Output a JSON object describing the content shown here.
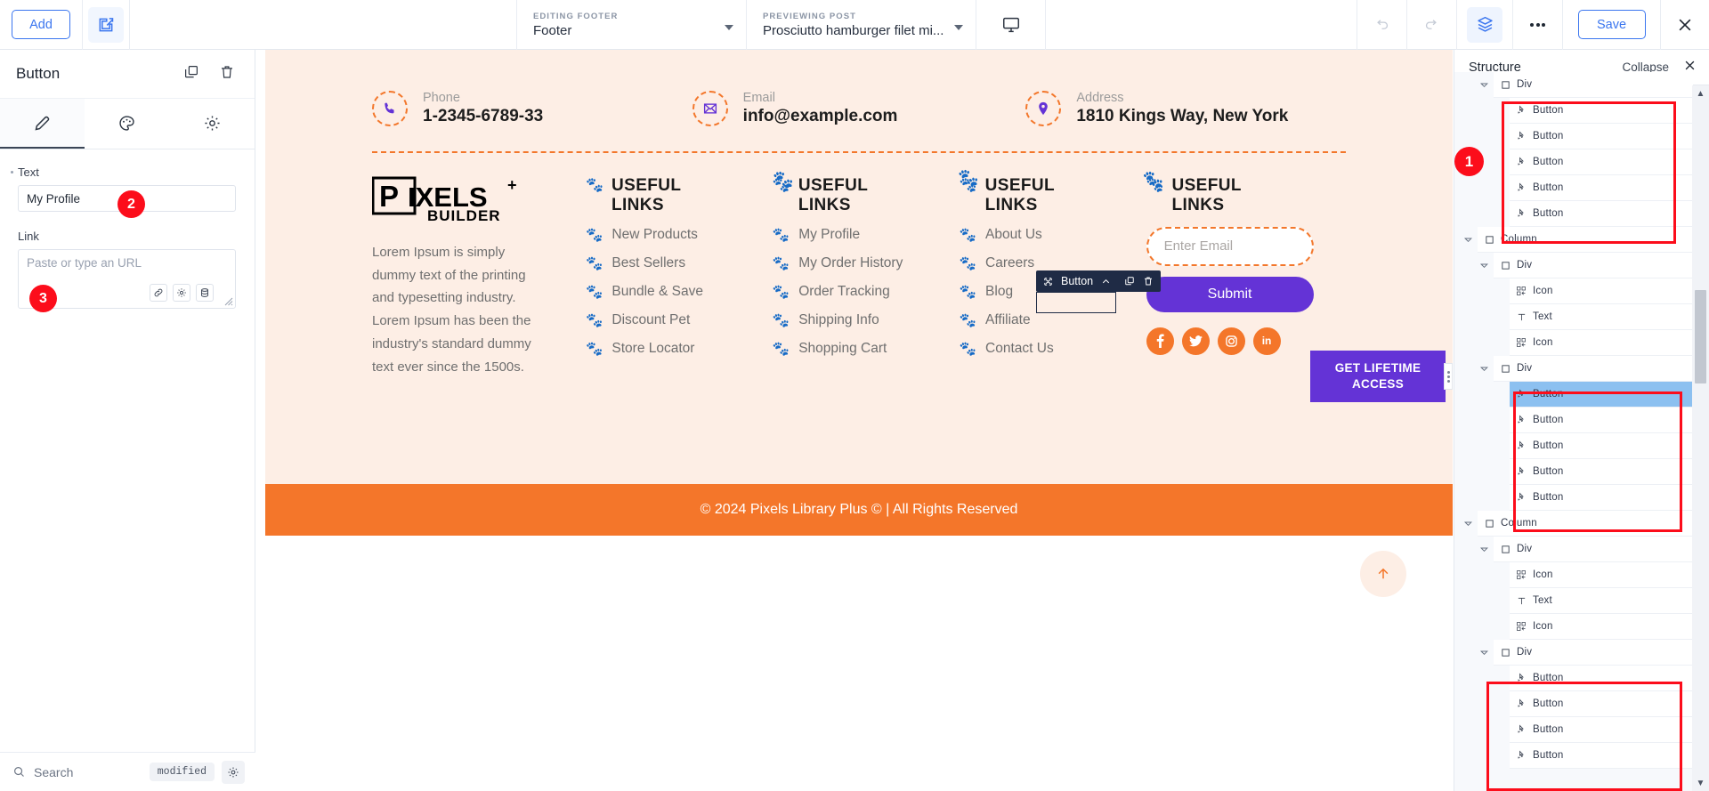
{
  "topbar": {
    "add_label": "Add",
    "edit_icon": "edit-square-icon",
    "editing": {
      "label": "EDITING FOOTER",
      "value": "Footer"
    },
    "previewing": {
      "label": "PREVIEWING POST",
      "value": "Prosciutto hamburger filet mi..."
    },
    "device_icon": "desktop-monitor-icon",
    "undo_icon": "undo-icon",
    "redo_icon": "redo-icon",
    "layers_icon": "layers-icon",
    "more_icon": "more-dots-icon",
    "save_label": "Save",
    "close_icon": "close-icon"
  },
  "left_panel": {
    "title": "Button",
    "duplicate_icon": "duplicate-icon",
    "delete_icon": "trash-icon",
    "tabs": [
      {
        "name": "content",
        "icon": "pencil-icon",
        "active": true
      },
      {
        "name": "style",
        "icon": "palette-icon",
        "active": false
      },
      {
        "name": "advanced",
        "icon": "gear-icon",
        "active": false
      }
    ],
    "text_field": {
      "label": "Text",
      "value": "My Profile"
    },
    "link_field": {
      "label": "Link",
      "placeholder": "Paste or type an URL"
    },
    "link_buttons": [
      {
        "name": "link-icon"
      },
      {
        "name": "gear-icon"
      },
      {
        "name": "database-icon"
      }
    ],
    "footer": {
      "search_placeholder": "Search",
      "status_badge": "modified",
      "settings_icon": "gear-icon"
    }
  },
  "canvas": {
    "contact": [
      {
        "icon": "phone-icon",
        "label": "Phone",
        "value": "1-2345-6789-33"
      },
      {
        "icon": "envelope-icon",
        "label": "Email",
        "value": "info@example.com"
      },
      {
        "icon": "map-pin-icon",
        "label": "Address",
        "value": "1810 Kings Way, New York"
      }
    ],
    "brand": {
      "logo_text": "PIXELS BUILDER",
      "description": "Lorem Ipsum is simply dummy text of the printing and typesetting industry. Lorem Ipsum has been the industry's standard dummy text ever since the 1500s."
    },
    "columns": [
      {
        "heading": "USEFUL LINKS",
        "links": [
          "New Products",
          "Best Sellers",
          "Bundle & Save",
          "Discount Pet",
          "Store Locator"
        ]
      },
      {
        "heading": "USEFUL LINKS",
        "links": [
          "My Profile",
          "My Order History",
          "Order Tracking",
          "Shipping Info",
          "Shopping Cart"
        ]
      },
      {
        "heading": "USEFUL LINKS",
        "links": [
          "About Us",
          "Careers",
          "Blog",
          "Affiliate",
          "Contact Us"
        ]
      }
    ],
    "newsletter": {
      "heading": "USEFUL LINKS",
      "email_placeholder": "Enter Email",
      "submit_label": "Submit",
      "socials": [
        {
          "name": "facebook-icon",
          "glyph": "f"
        },
        {
          "name": "twitter-icon",
          "glyph": "⚑"
        },
        {
          "name": "instagram-icon",
          "glyph": "◎"
        },
        {
          "name": "linkedin-icon",
          "glyph": "in"
        }
      ]
    },
    "cta_label": "GET LIFETIME ACCESS",
    "copyright": "© 2024 Pixels Library Plus © | All Rights Reserved",
    "scroll_top_icon": "arrow-up-icon",
    "element_toolbar": {
      "move_icon": "move-icon",
      "label": "Button",
      "collapse_icon": "chevron-up-icon",
      "duplicate_icon": "duplicate-icon",
      "delete_icon": "trash-icon"
    }
  },
  "structure": {
    "title": "Structure",
    "collapse_label": "Collapse",
    "close_icon": "close-icon",
    "nodes": [
      {
        "label": "Div",
        "icon": "div-icon",
        "depth": 2,
        "arrow": true,
        "selected": false
      },
      {
        "label": "Button",
        "icon": "button-icon",
        "depth": 3,
        "arrow": false,
        "selected": false
      },
      {
        "label": "Button",
        "icon": "button-icon",
        "depth": 3,
        "arrow": false,
        "selected": false
      },
      {
        "label": "Button",
        "icon": "button-icon",
        "depth": 3,
        "arrow": false,
        "selected": false
      },
      {
        "label": "Button",
        "icon": "button-icon",
        "depth": 3,
        "arrow": false,
        "selected": false
      },
      {
        "label": "Button",
        "icon": "button-icon",
        "depth": 3,
        "arrow": false,
        "selected": false
      },
      {
        "label": "Column",
        "icon": "div-icon",
        "depth": 1,
        "arrow": true,
        "selected": false
      },
      {
        "label": "Div",
        "icon": "div-icon",
        "depth": 2,
        "arrow": true,
        "selected": false
      },
      {
        "label": "Icon",
        "icon": "icon-icon",
        "depth": 3,
        "arrow": false,
        "selected": false
      },
      {
        "label": "Text",
        "icon": "text-icon",
        "depth": 3,
        "arrow": false,
        "selected": false
      },
      {
        "label": "Icon",
        "icon": "icon-icon",
        "depth": 3,
        "arrow": false,
        "selected": false
      },
      {
        "label": "Div",
        "icon": "div-icon",
        "depth": 2,
        "arrow": true,
        "selected": false
      },
      {
        "label": "Button",
        "icon": "button-icon",
        "depth": 3,
        "arrow": false,
        "selected": true
      },
      {
        "label": "Button",
        "icon": "button-icon",
        "depth": 3,
        "arrow": false,
        "selected": false
      },
      {
        "label": "Button",
        "icon": "button-icon",
        "depth": 3,
        "arrow": false,
        "selected": false
      },
      {
        "label": "Button",
        "icon": "button-icon",
        "depth": 3,
        "arrow": false,
        "selected": false
      },
      {
        "label": "Button",
        "icon": "button-icon",
        "depth": 3,
        "arrow": false,
        "selected": false
      },
      {
        "label": "Column",
        "icon": "div-icon",
        "depth": 1,
        "arrow": true,
        "selected": false
      },
      {
        "label": "Div",
        "icon": "div-icon",
        "depth": 2,
        "arrow": true,
        "selected": false
      },
      {
        "label": "Icon",
        "icon": "icon-icon",
        "depth": 3,
        "arrow": false,
        "selected": false
      },
      {
        "label": "Text",
        "icon": "text-icon",
        "depth": 3,
        "arrow": false,
        "selected": false
      },
      {
        "label": "Icon",
        "icon": "icon-icon",
        "depth": 3,
        "arrow": false,
        "selected": false
      },
      {
        "label": "Div",
        "icon": "div-icon",
        "depth": 2,
        "arrow": true,
        "selected": false
      },
      {
        "label": "Button",
        "icon": "button-icon",
        "depth": 3,
        "arrow": false,
        "selected": false
      },
      {
        "label": "Button",
        "icon": "button-icon",
        "depth": 3,
        "arrow": false,
        "selected": false
      },
      {
        "label": "Button",
        "icon": "button-icon",
        "depth": 3,
        "arrow": false,
        "selected": false
      },
      {
        "label": "Button",
        "icon": "button-icon",
        "depth": 3,
        "arrow": false,
        "selected": false
      }
    ]
  },
  "annotations": [
    {
      "number": "1"
    },
    {
      "number": "2"
    },
    {
      "number": "3"
    }
  ],
  "colors": {
    "accent_blue": "#3b76ef",
    "footer_bg": "#fdeee5",
    "orange": "#f4762a",
    "purple": "#6433d6",
    "annotation_red": "#fc0d1b",
    "tree_selected": "#8cc0f0",
    "toolbar_dark": "#1f2b45"
  }
}
